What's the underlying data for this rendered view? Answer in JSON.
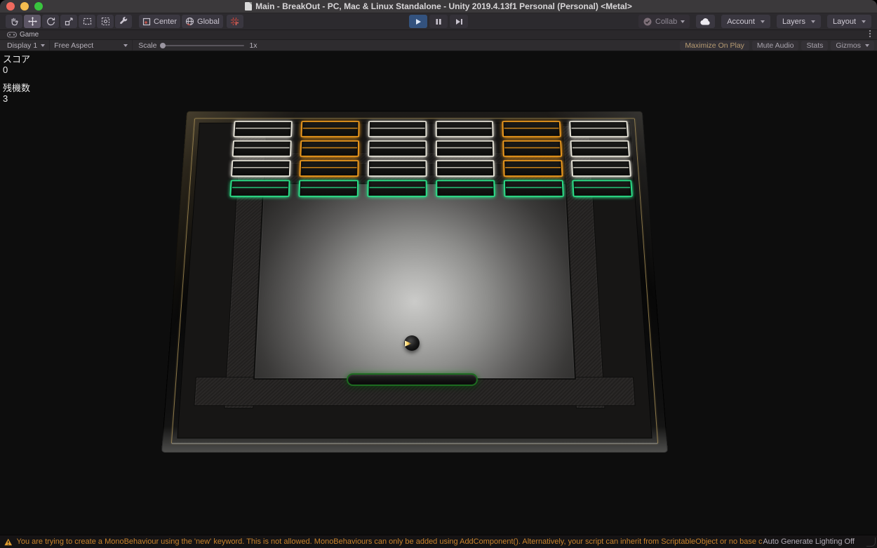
{
  "window": {
    "title": "Main - BreakOut - PC, Mac & Linux Standalone - Unity 2019.4.13f1 Personal (Personal) <Metal>"
  },
  "toolbar": {
    "tool_icons": [
      "hand-tool-icon",
      "move-tool-icon",
      "rotate-tool-icon",
      "scale-tool-icon",
      "rect-tool-icon",
      "transform-tool-icon",
      "custom-tool-icon"
    ],
    "selected_tool": "move-tool",
    "pivot_label": "Center",
    "orientation_label": "Global",
    "snap_icon": "grid-snap-icon",
    "play_icons": [
      "play-icon",
      "pause-icon",
      "step-icon"
    ],
    "play_state": "playing",
    "collab_label": "Collab",
    "cloud_icon": "cloud-icon",
    "account_label": "Account",
    "layers_label": "Layers",
    "layout_label": "Layout"
  },
  "tabbar": {
    "game_tab_label": "Game",
    "kebab_icon": "kebab-menu-icon"
  },
  "game_toolbar": {
    "display_label": "Display 1",
    "aspect_label": "Free Aspect",
    "scale_label": "Scale",
    "scale_value": "1x",
    "maximize_label": "Maximize On Play",
    "mute_label": "Mute Audio",
    "stats_label": "Stats",
    "gizmos_label": "Gizmos"
  },
  "hud": {
    "score_label": "スコア",
    "score_value": "0",
    "lives_label": "残機数",
    "lives_value": "3"
  },
  "game": {
    "brick_rows": [
      {
        "colors": [
          "white",
          "orange",
          "white",
          "white",
          "orange",
          "white"
        ]
      },
      {
        "colors": [
          "white",
          "orange",
          "white",
          "white",
          "orange",
          "white"
        ]
      },
      {
        "colors": [
          "white",
          "orange",
          "white",
          "white",
          "orange",
          "white"
        ]
      },
      {
        "colors": [
          "green",
          "green",
          "green",
          "green",
          "green",
          "green"
        ]
      }
    ],
    "brick_colors": {
      "white": "#e9e6da",
      "orange": "#f09b1d",
      "green": "#2be289"
    },
    "paddle_edge_color": "#1d6b20",
    "ball_highlight_color": "#ffcf5a"
  },
  "colors": {
    "warning_color": "#c9842d",
    "maximize_color": "#b59a72",
    "play_active_bg": "#33527e",
    "snap_icon_color": "#b5443c"
  },
  "statusbar": {
    "warning_text": "You are trying to create a MonoBehaviour using the 'new' keyword.  This is not allowed.  MonoBehaviours can only be added using AddComponent(). Alternatively, your script can inherit from ScriptableObject or no base class at all",
    "right_label": "Auto Generate Lighting Off"
  }
}
